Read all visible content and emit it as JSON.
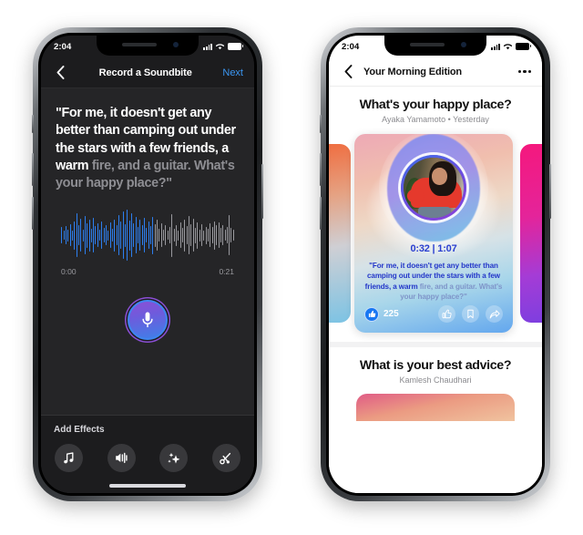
{
  "left_phone": {
    "status_bar": {
      "time": "2:04",
      "signal_icon": "cellular-bars-icon",
      "wifi_icon": "wifi-icon",
      "battery_icon": "battery-full-icon"
    },
    "nav": {
      "back_icon": "chevron-left-icon",
      "title": "Record a Soundbite",
      "next_label": "Next",
      "next_color": "#3b97f3"
    },
    "prompt": {
      "spoken": "\"For me, it doesn't get any better than camping out under the stars with a few friends, a warm ",
      "remaining": "fire, and a guitar. What's your happy place?\"",
      "spoken_color": "#ffffff",
      "remaining_color": "#8e8e93"
    },
    "waveform": {
      "played_color": "#2d7ff0",
      "unplayed_color": "#9a9a9f",
      "played_count": 44,
      "amplitudes": [
        18,
        10,
        20,
        13,
        24,
        11,
        31,
        48,
        22,
        36,
        13,
        42,
        27,
        35,
        15,
        38,
        20,
        26,
        12,
        30,
        16,
        22,
        11,
        28,
        14,
        35,
        22,
        44,
        30,
        52,
        25,
        56,
        33,
        48,
        26,
        40,
        18,
        34,
        22,
        38,
        16,
        30,
        20,
        41,
        25,
        34,
        14,
        26,
        12,
        22,
        10,
        18,
        47,
        14,
        23,
        11,
        28,
        16,
        35,
        20,
        42,
        24,
        36,
        17,
        29,
        13,
        24,
        11,
        19,
        14,
        26,
        18,
        31,
        22,
        28,
        16,
        22,
        12,
        18,
        44,
        16,
        12
      ],
      "start_time": "0:00",
      "end_time": "0:21"
    },
    "record_button": {
      "icon": "microphone-icon",
      "gradient_start": "#8b4fd6",
      "gradient_end": "#3f7fe8"
    },
    "effects": {
      "title": "Add Effects",
      "buttons": [
        {
          "icon": "music-note-icon",
          "name": "effect-music"
        },
        {
          "icon": "voice-effect-icon",
          "name": "effect-voice"
        },
        {
          "icon": "sparkles-icon",
          "name": "effect-sparkles"
        },
        {
          "icon": "scissors-icon",
          "name": "effect-trim"
        }
      ]
    }
  },
  "right_phone": {
    "status_bar": {
      "time": "2:04",
      "signal_icon": "cellular-bars-icon",
      "wifi_icon": "wifi-icon",
      "battery_icon": "battery-full-icon"
    },
    "nav": {
      "back_icon": "chevron-left-icon",
      "title": "Your Morning Edition",
      "overflow_icon": "more-horizontal-icon"
    },
    "section_1": {
      "title": "What's your happy place?",
      "subtitle": "Ayaka Yamamoto • Yesterday",
      "card": {
        "time_current": "0:32",
        "time_total": "1:07",
        "time_display": "0:32 | 1:07",
        "time_color": "#2a3fd0",
        "transcript_spoken": "\"For me, it doesn't get any better than camping out under the stars with a few friends, a warm ",
        "transcript_remaining": "fire, and a guitar. What's your happy place?\"",
        "spoken_color": "#2336c9",
        "remaining_color": "#7f95c9",
        "avatar_name": "avatar",
        "like_count": "225",
        "like_icon": "thumbs-up-filled-icon",
        "actions": [
          {
            "icon": "thumbs-up-outline-icon",
            "name": "like-button"
          },
          {
            "icon": "bookmark-icon",
            "name": "save-button"
          },
          {
            "icon": "share-arrow-icon",
            "name": "share-button"
          }
        ]
      }
    },
    "section_2": {
      "title": "What is your best advice?",
      "subtitle": "Kamlesh Chaudhari"
    }
  }
}
